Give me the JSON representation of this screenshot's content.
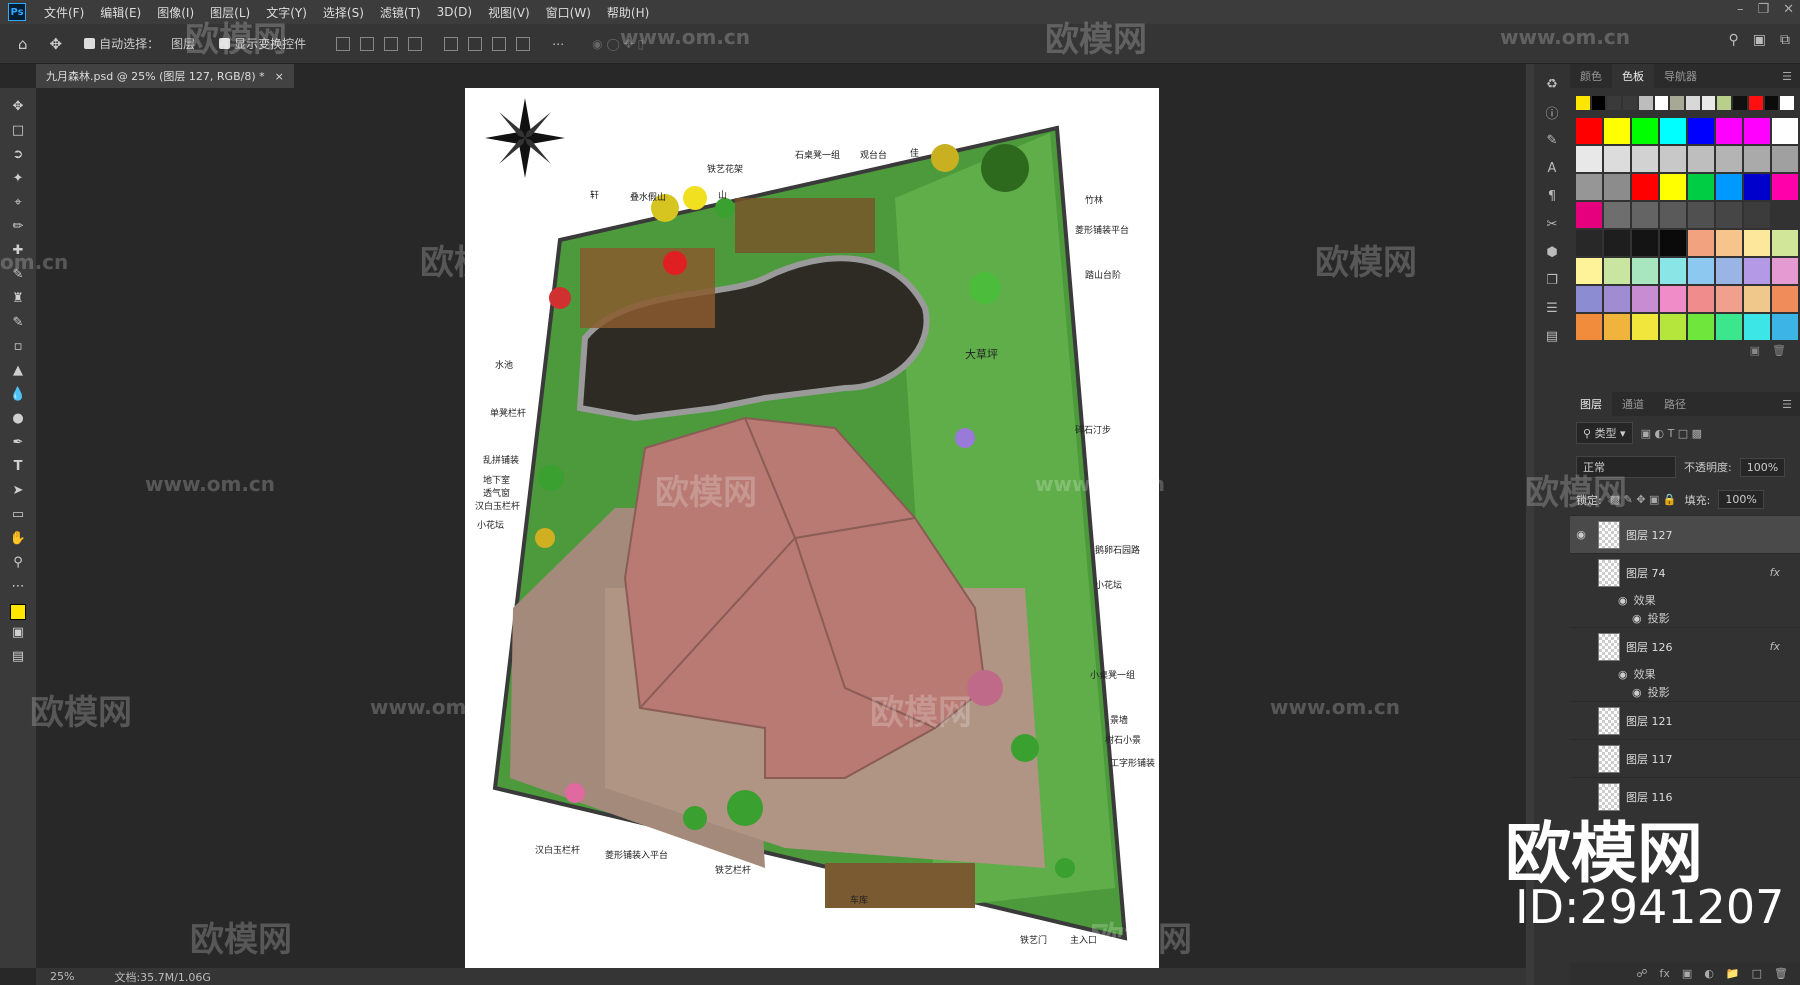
{
  "app": {
    "logo": "Ps"
  },
  "menu": [
    "文件(F)",
    "编辑(E)",
    "图像(I)",
    "图层(L)",
    "文字(Y)",
    "选择(S)",
    "滤镜(T)",
    "3D(D)",
    "视图(V)",
    "窗口(W)",
    "帮助(H)"
  ],
  "options": {
    "auto_select": "自动选择：",
    "auto_select_target": "图层",
    "show_transform": "显示变换控件"
  },
  "document": {
    "tab_title": "九月森林.psd @ 25% (图层 127, RGB/8) *",
    "close": "×"
  },
  "status": {
    "zoom": "25%",
    "doc_size": "文档:35.7M/1.06G"
  },
  "color_panel": {
    "tabs": [
      "颜色",
      "色板",
      "导航器"
    ],
    "active": "色板"
  },
  "recent_swatches": [
    "#ffe600",
    "#000000",
    "#3a3a3a",
    "#3a3a3a",
    "#bdbdbd",
    "#ffffff",
    "#a8a896",
    "#d8d8d8",
    "#eaeaea",
    "#b8d08a",
    "#111111",
    "#ff1010",
    "#0b0b0b",
    "#ffffff"
  ],
  "swatches": [
    "#ff0000",
    "#ffff00",
    "#00ff00",
    "#00ffff",
    "#0000ff",
    "#ff00ff",
    "#ff00ff",
    "#ffffff",
    "#e8e8e8",
    "#dcdcdc",
    "#d2d2d2",
    "#c8c8c8",
    "#bebebe",
    "#b4b4b4",
    "#aaaaaa",
    "#a0a0a0",
    "#969696",
    "#8c8c8c",
    "#ff0000",
    "#ffff00",
    "#00cc44",
    "#0099ff",
    "#0000cc",
    "#ff00aa",
    "#e6007e",
    "#6e6e6e",
    "#646464",
    "#5a5a5a",
    "#505050",
    "#464646",
    "#3c3c3c",
    "#323232",
    "#282828",
    "#1e1e1e",
    "#141414",
    "#0a0a0a",
    "#f2a27e",
    "#f7c48c",
    "#fce79a",
    "#d2e69a",
    "#fff39a",
    "#c8e6a0",
    "#a8e6c0",
    "#8ae6e6",
    "#8cc8f0",
    "#9ab4e6",
    "#b49ae6",
    "#e69ad2",
    "#8c8cd2",
    "#a08cd2",
    "#c88cd2",
    "#f08cc8",
    "#f08c8c",
    "#f0a08c",
    "#f0c88c",
    "#f08c5a",
    "#f08c3c",
    "#f0b43c",
    "#f0e63c",
    "#b4e63c",
    "#6ee63c",
    "#3ce68c",
    "#3ce6e6",
    "#3cb4e6"
  ],
  "layers_panel": {
    "tabs": [
      "图层",
      "通道",
      "路径"
    ],
    "filter_label": "类型",
    "blend_mode": "正常",
    "opacity_label": "不透明度:",
    "opacity": "100%",
    "lock_label": "锁定:",
    "fill_label": "填充:",
    "fill": "100%",
    "layers": [
      {
        "name": "图层 127",
        "visible": true,
        "fx": "",
        "effects": []
      },
      {
        "name": "图层 74",
        "visible": false,
        "fx": "fx",
        "effects": [
          "效果",
          "投影"
        ]
      },
      {
        "name": "图层 126",
        "visible": false,
        "fx": "fx",
        "effects": [
          "效果",
          "投影"
        ]
      },
      {
        "name": "图层 121",
        "visible": false,
        "fx": "",
        "effects": []
      },
      {
        "name": "图层 117",
        "visible": false,
        "fx": "",
        "effects": []
      },
      {
        "name": "图层 116",
        "visible": false,
        "fx": "",
        "effects": []
      }
    ]
  },
  "plan_labels": [
    "铁艺花架",
    "石桌凳一组",
    "观台台",
    "佳",
    "竹林",
    "菱形铺装平台",
    "叠水假山",
    "山",
    "轩",
    "踏山台阶",
    "水池",
    "单凳栏杆",
    "乱拼铺装",
    "地下室",
    "透气窗",
    "汉白玉栏杆",
    "小花坛",
    "大草坪",
    "碎石汀步",
    "鹅卵石园路",
    "小花坛",
    "小桌凳一组",
    "景墙",
    "树石小景",
    "工字形铺装",
    "汉白玉栏杆",
    "菱形铺装入平台",
    "铁艺栏杆",
    "车库",
    "铁艺门",
    "主入口"
  ],
  "watermarks": {
    "site": "欧模网",
    "url": "www.om.cn",
    "url2": "om.cn",
    "brand_big": "欧模网",
    "brand_id": "ID:2941207"
  }
}
